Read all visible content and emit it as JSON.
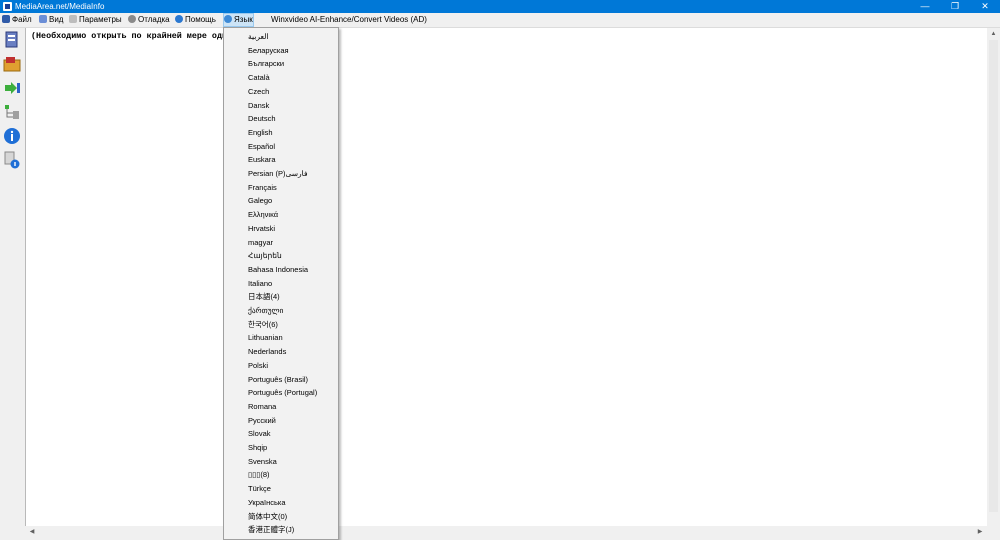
{
  "window": {
    "title": "MediaArea.net/MediaInfo",
    "minimize": "—",
    "maximize": "❐",
    "close": "✕"
  },
  "menu": [
    {
      "label": "Файл",
      "icon": "folder-icon",
      "color": "#2f5aa8"
    },
    {
      "label": "Вид",
      "icon": "view-icon",
      "color": "#6b8ed6"
    },
    {
      "label": "Параметры",
      "icon": "options-icon",
      "color": "#9a9a9a"
    },
    {
      "label": "Отладка",
      "icon": "debug-icon",
      "color": "#7a7a7a"
    },
    {
      "label": "Помощь",
      "icon": "help-icon",
      "color": "#2b78d0"
    },
    {
      "label": "Язык",
      "icon": "globe-icon",
      "color": "#3d8ad6"
    },
    {
      "label": "Winxvideo AI-Enhance/Convert Videos (AD)",
      "icon": "",
      "color": ""
    }
  ],
  "content": {
    "message": "(Необходимо открыть по крайней мере оди"
  },
  "languages": [
    "العربية",
    "Беларуская",
    "Български",
    "Català",
    "Czech",
    "Dansk",
    "Deutsch",
    "English",
    "Español",
    "Euskara",
    "Persian  (P)فارسی",
    "Français",
    "Galego",
    "Ελληνικά",
    "Hrvatski",
    "magyar",
    "Հայերեն",
    "Bahasa Indonesia",
    "Italiano",
    "日本語(4)",
    "ქართული",
    "한국어(6)",
    "Lithuanian",
    "Nederlands",
    "Polski",
    "Português (Brasil)",
    "Português (Portugal)",
    "Romana",
    "Русский",
    "Slovak",
    "Shqip",
    "Svenska",
    "▯▯▯(8)",
    "Türkçe",
    "Українська",
    "简体中文(0)",
    "香港正體字(J)"
  ]
}
